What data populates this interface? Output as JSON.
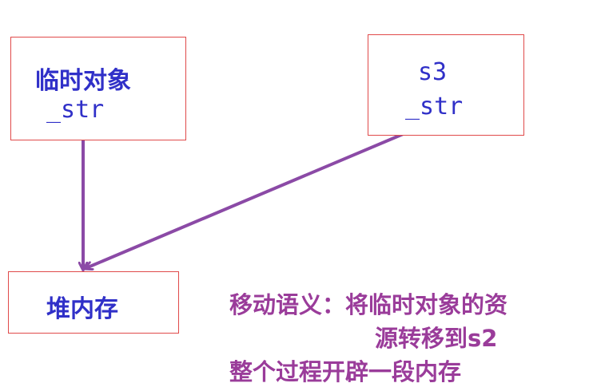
{
  "diagram": {
    "temp_box": {
      "title": "临时对象",
      "field": "_str"
    },
    "s3_box": {
      "title": "s3",
      "field": "_str"
    },
    "heap_box": {
      "title": "堆内存"
    },
    "caption": {
      "line1": "移动语义：将临时对象的资",
      "line2": "源转移到s2",
      "line3": "整个过程开辟一段内存"
    }
  },
  "colors": {
    "box_border": "#e04a4a",
    "box_text": "#3030c8",
    "arrow": "#8b4aa6",
    "caption": "#9a3c9a"
  }
}
